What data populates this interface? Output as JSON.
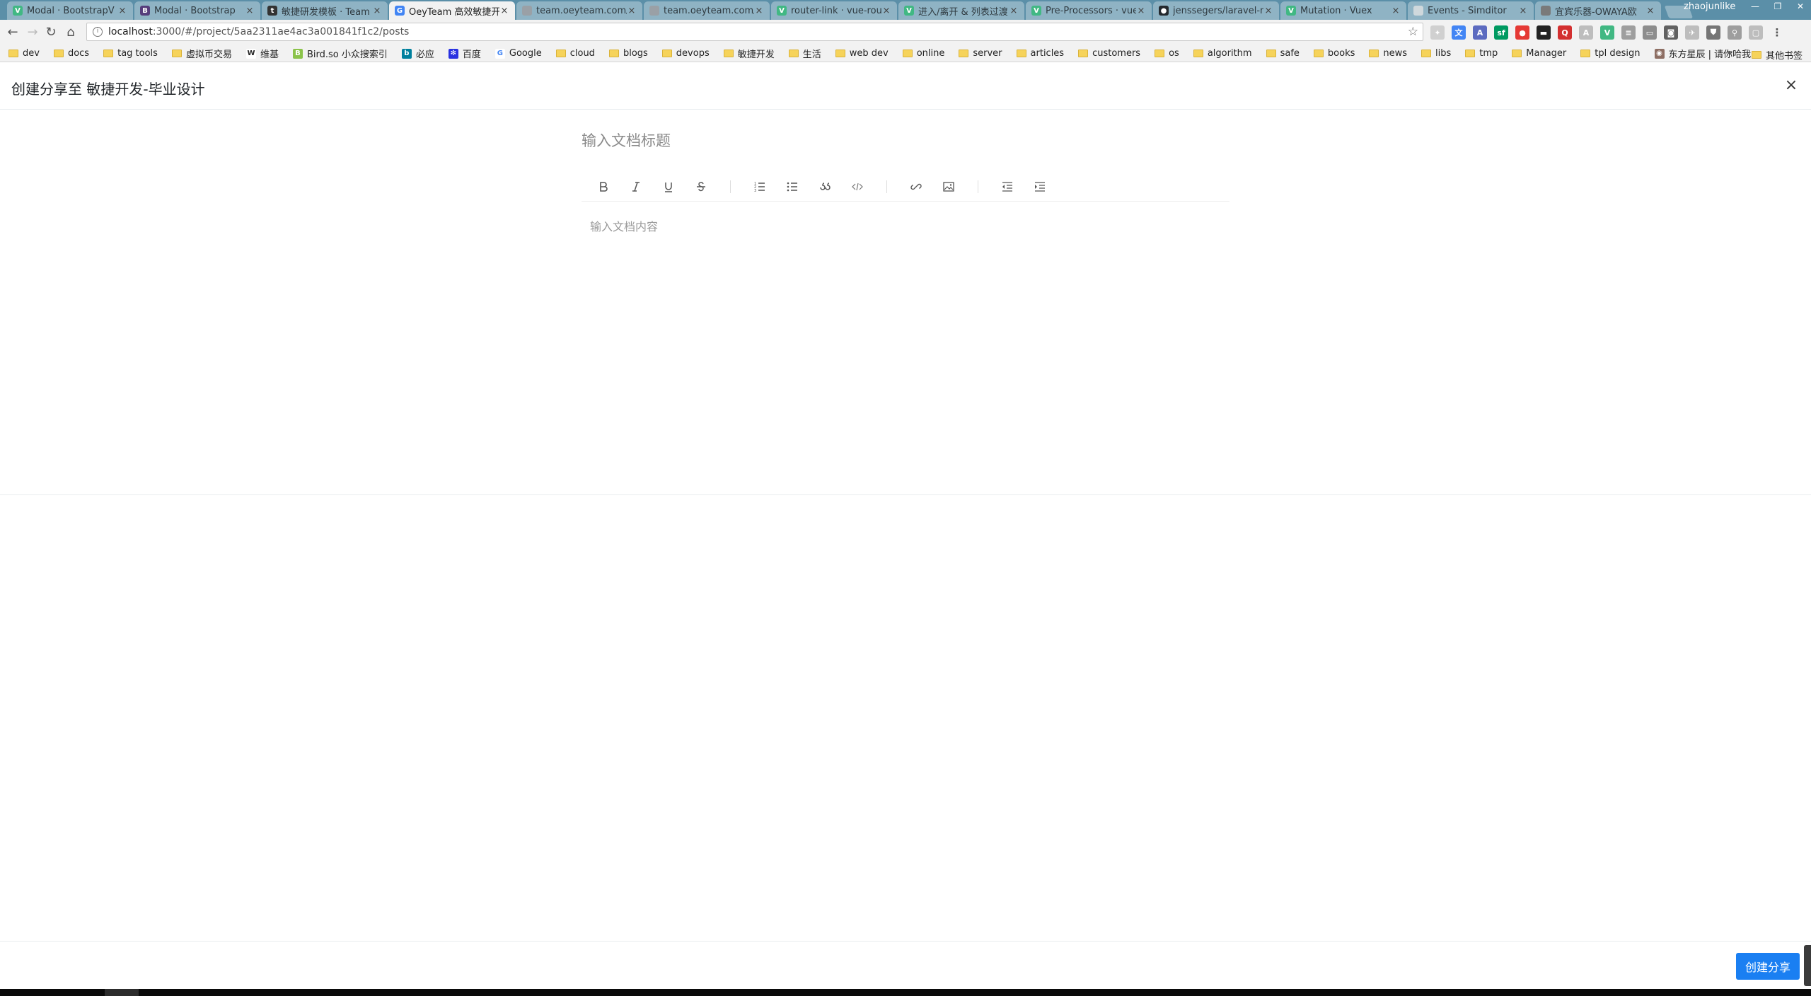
{
  "browser": {
    "tabs": [
      {
        "title": "Modal · BootstrapV",
        "icon": "bootstrapvue-icon",
        "color": "#41b883",
        "glyph": "V",
        "active": false
      },
      {
        "title": "Modal · Bootstrap",
        "icon": "bootstrap-icon",
        "color": "#563d7c",
        "glyph": "B",
        "active": false
      },
      {
        "title": "敏捷研发模板 · Team",
        "icon": "teambition-icon",
        "color": "#333333",
        "glyph": "t",
        "active": false
      },
      {
        "title": "OeyTeam 高效敏捷开",
        "icon": "google-icon",
        "color": "#4285f4",
        "glyph": "G",
        "active": true
      },
      {
        "title": "team.oeyteam.com/",
        "icon": "page-icon",
        "color": "#9aa0a6",
        "glyph": "",
        "active": false
      },
      {
        "title": "team.oeyteam.com/",
        "icon": "page-icon",
        "color": "#9aa0a6",
        "glyph": "",
        "active": false
      },
      {
        "title": "router-link · vue-rou",
        "icon": "vue-icon",
        "color": "#41b883",
        "glyph": "V",
        "active": false
      },
      {
        "title": "进入/离开 & 列表过渡",
        "icon": "vue-icon",
        "color": "#41b883",
        "glyph": "V",
        "active": false
      },
      {
        "title": "Pre-Processors · vue",
        "icon": "vue-icon",
        "color": "#41b883",
        "glyph": "V",
        "active": false
      },
      {
        "title": "jenssegers/laravel-m",
        "icon": "github-icon",
        "color": "#24292e",
        "glyph": "●",
        "active": false
      },
      {
        "title": "Mutation · Vuex",
        "icon": "vue-icon",
        "color": "#41b883",
        "glyph": "V",
        "active": false
      },
      {
        "title": "Events - Simditor",
        "icon": "simditor-icon",
        "color": "#cfd8dc",
        "glyph": "",
        "active": false
      },
      {
        "title": "宜宾乐器-OWAYA欧",
        "icon": "owaya-icon",
        "color": "#7a7a7a",
        "glyph": "",
        "active": false
      }
    ],
    "tab_close": "×",
    "profile": "zhaojunlike",
    "window_controls": {
      "minimize": "—",
      "restore": "❐",
      "close": "✕"
    },
    "nav": {
      "back": "←",
      "forward": "→",
      "reload": "↻",
      "home": "⌂"
    },
    "url": {
      "host": "localhost",
      "rest": ":3000/#/project/5aa2311ae4ac3a001841f1c2/posts",
      "info": "i",
      "star": "☆"
    },
    "extensions": [
      {
        "icon": "lastpass-icon",
        "color": "#d0d0d0",
        "glyph": "✦"
      },
      {
        "icon": "translate-icon",
        "color": "#4285f4",
        "glyph": "文"
      },
      {
        "icon": "translate-alt-icon",
        "color": "#5c6bc0",
        "glyph": "A"
      },
      {
        "icon": "segmentfault-icon",
        "color": "#009a61",
        "glyph": "sf"
      },
      {
        "icon": "circle-red-icon",
        "color": "#e53935",
        "glyph": "●"
      },
      {
        "icon": "terminal-icon",
        "color": "#222222",
        "glyph": "▬"
      },
      {
        "icon": "red-square-icon",
        "color": "#d32f2f",
        "glyph": "Q"
      },
      {
        "icon": "font-icon",
        "color": "#bdbdbd",
        "glyph": "A"
      },
      {
        "icon": "vue-devtools-icon",
        "color": "#41b883",
        "glyph": "V"
      },
      {
        "icon": "reader-icon",
        "color": "#9e9e9e",
        "glyph": "≡"
      },
      {
        "icon": "tablet-icon",
        "color": "#8d8d8d",
        "glyph": "▭"
      },
      {
        "icon": "camera-icon",
        "color": "#616161",
        "glyph": "◙"
      },
      {
        "icon": "bird-icon",
        "color": "#bdbdbd",
        "glyph": "✈"
      },
      {
        "icon": "shield-icon",
        "color": "#757575",
        "glyph": "⛊"
      },
      {
        "icon": "zoom-icon",
        "color": "#9e9e9e",
        "glyph": "⚲"
      },
      {
        "icon": "window-icon",
        "color": "#bdbdbd",
        "glyph": "▢"
      },
      {
        "icon": "menu-icon",
        "color": "#f2f2f2",
        "glyph": "⋮"
      }
    ],
    "bookmarks": [
      {
        "label": "dev",
        "type": "folder"
      },
      {
        "label": "docs",
        "type": "folder"
      },
      {
        "label": "tag tools",
        "type": "folder"
      },
      {
        "label": "虚拟币交易",
        "type": "folder"
      },
      {
        "label": "维基",
        "type": "icon",
        "icon": "wikipedia-icon",
        "color": "#ffffff",
        "glyph": "W",
        "fg": "#222222"
      },
      {
        "label": "Bird.so 小众搜索引",
        "type": "icon",
        "icon": "bird-so-icon",
        "color": "#8bc34a",
        "glyph": "B",
        "fg": "#ffffff"
      },
      {
        "label": "必应",
        "type": "icon",
        "icon": "bing-icon",
        "color": "#00809d",
        "glyph": "b",
        "fg": "#ffffff"
      },
      {
        "label": "百度",
        "type": "icon",
        "icon": "baidu-icon",
        "color": "#2932e1",
        "glyph": "✻",
        "fg": "#ffffff"
      },
      {
        "label": "Google",
        "type": "icon",
        "icon": "google-icon",
        "color": "#ffffff",
        "glyph": "G",
        "fg": "#4285f4"
      },
      {
        "label": "cloud",
        "type": "folder"
      },
      {
        "label": "blogs",
        "type": "folder"
      },
      {
        "label": "devops",
        "type": "folder"
      },
      {
        "label": "敏捷开发",
        "type": "folder"
      },
      {
        "label": "生活",
        "type": "folder"
      },
      {
        "label": "web dev",
        "type": "folder"
      },
      {
        "label": "online",
        "type": "folder"
      },
      {
        "label": "server",
        "type": "folder"
      },
      {
        "label": "articles",
        "type": "folder"
      },
      {
        "label": "customers",
        "type": "folder"
      },
      {
        "label": "os",
        "type": "folder"
      },
      {
        "label": "algorithm",
        "type": "folder"
      },
      {
        "label": "safe",
        "type": "folder"
      },
      {
        "label": "books",
        "type": "folder"
      },
      {
        "label": "news",
        "type": "folder"
      },
      {
        "label": "libs",
        "type": "folder"
      },
      {
        "label": "tmp",
        "type": "folder"
      },
      {
        "label": "Manager",
        "type": "folder"
      },
      {
        "label": "tpl design",
        "type": "folder"
      },
      {
        "label": "东方星辰 | 请你哈我",
        "type": "icon",
        "icon": "site-icon",
        "color": "#8d6e63",
        "glyph": "◉",
        "fg": "#ffffff"
      }
    ],
    "bookmarks_more": "»",
    "other_bookmarks": "其他书签"
  },
  "modal": {
    "title": "创建分享至 敏捷开发-毕业设计",
    "close": "×",
    "doc_title_placeholder": "输入文档标题",
    "editor_placeholder": "输入文档内容",
    "submit_label": "创建分享"
  }
}
